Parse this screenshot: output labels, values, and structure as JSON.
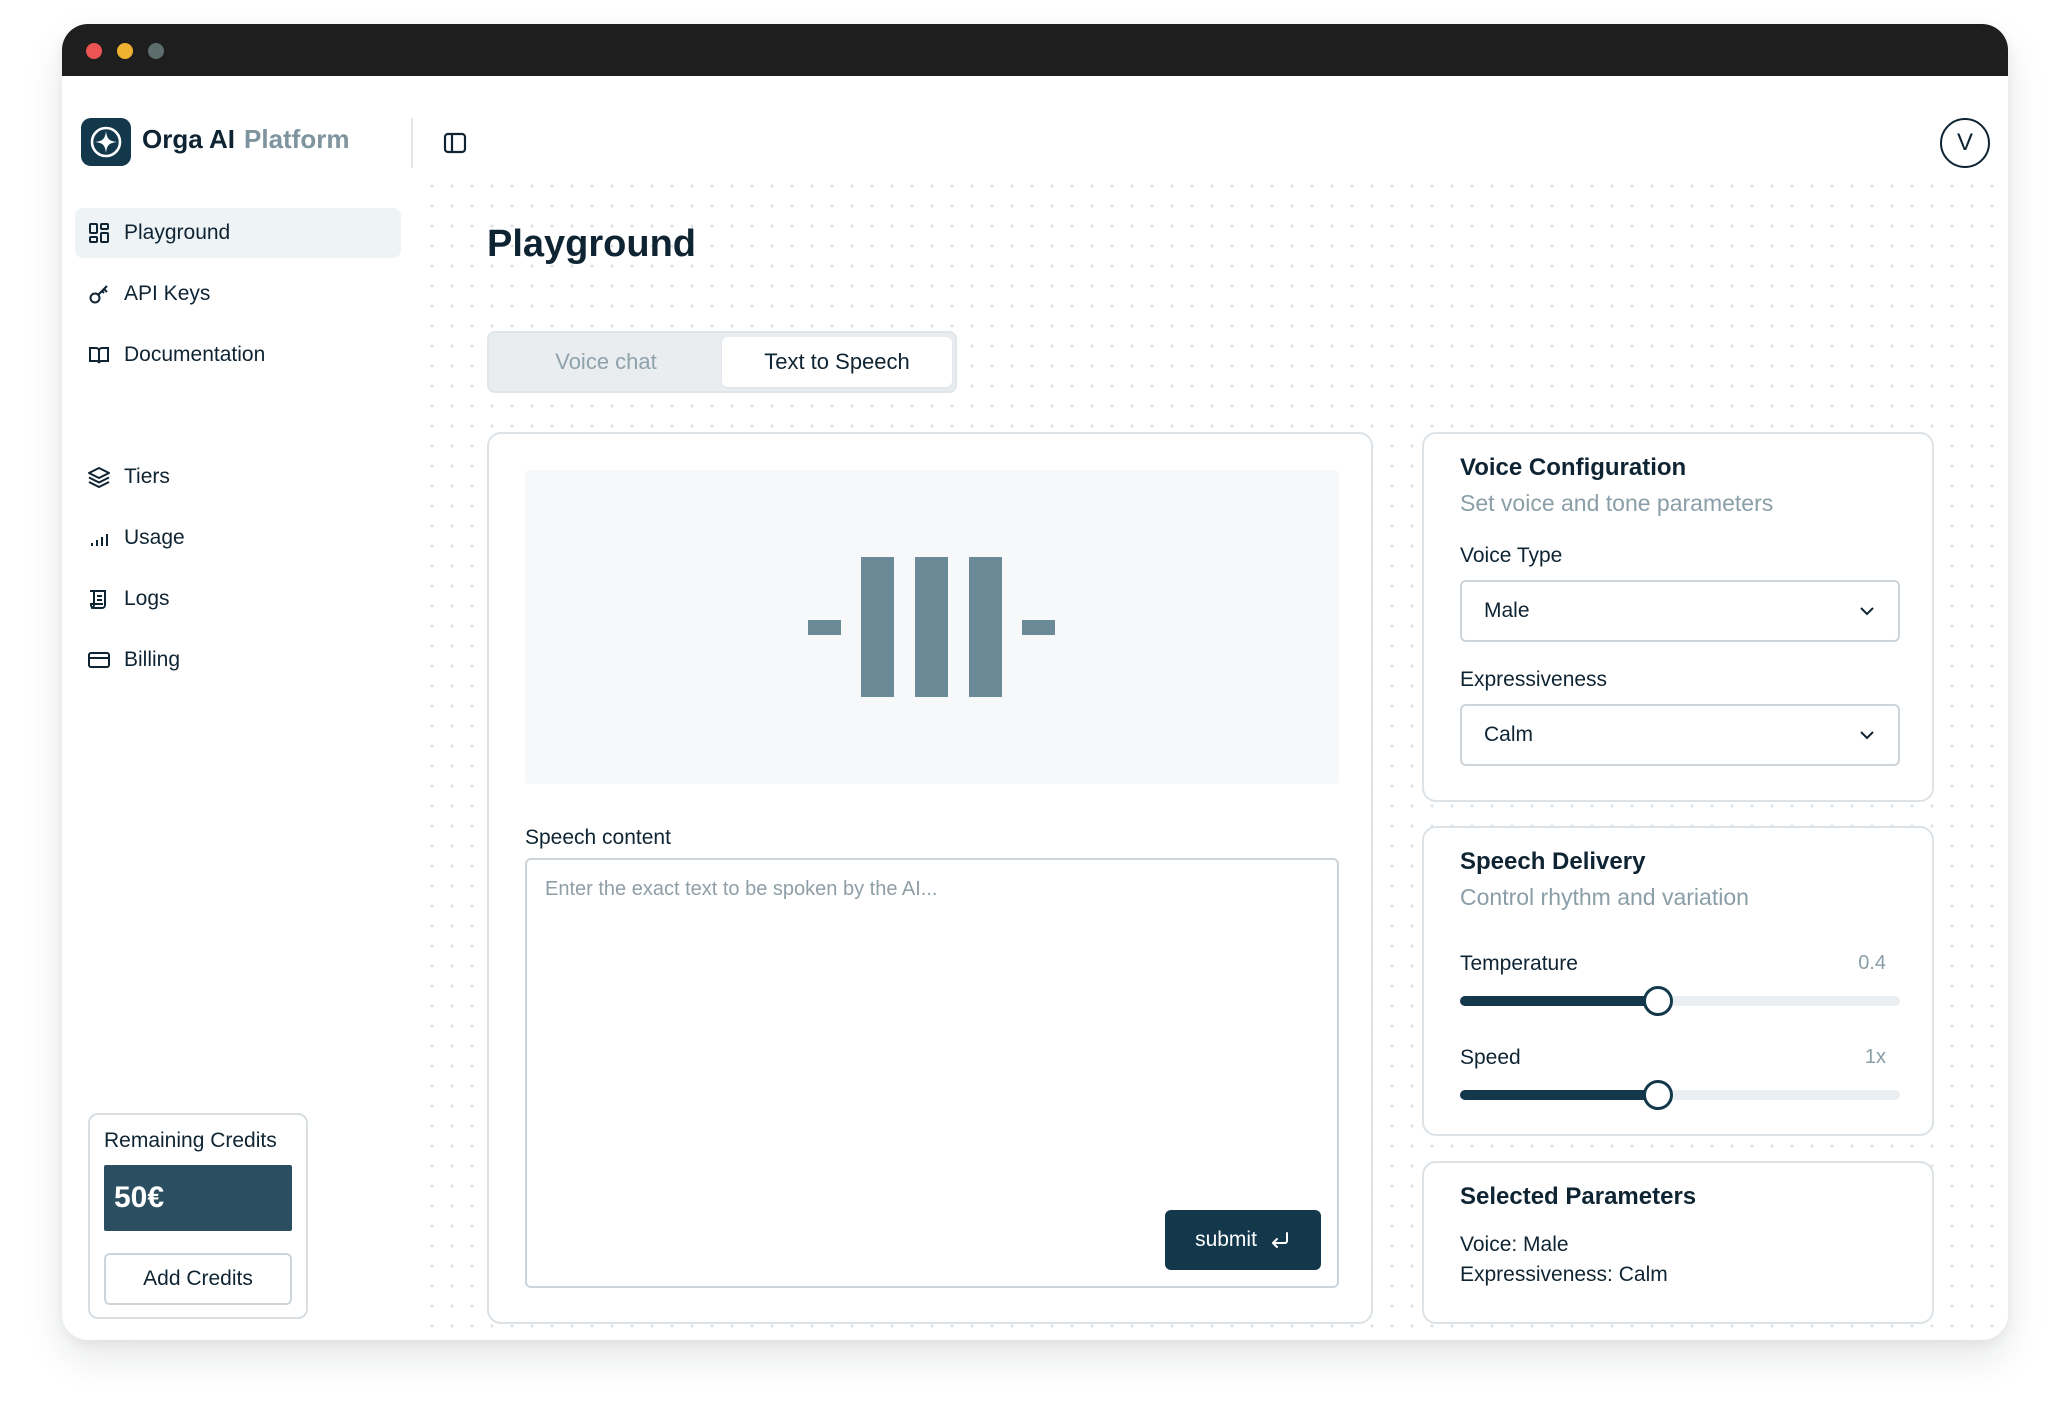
{
  "brand": {
    "name": "Orga AI",
    "sub": "Platform"
  },
  "user": {
    "initial": "V"
  },
  "sidebar": {
    "items": [
      {
        "label": "Playground",
        "icon": "grid-icon",
        "active": true
      },
      {
        "label": "API Keys",
        "icon": "key-icon"
      },
      {
        "label": "Documentation",
        "icon": "book-icon"
      },
      {
        "label": "Tiers",
        "icon": "layers-icon"
      },
      {
        "label": "Usage",
        "icon": "bar-chart-icon"
      },
      {
        "label": "Logs",
        "icon": "scroll-icon"
      },
      {
        "label": "Billing",
        "icon": "credit-card-icon"
      }
    ],
    "credits": {
      "title": "Remaining Credits",
      "value": "50€",
      "button": "Add Credits"
    }
  },
  "main": {
    "title": "Playground",
    "tabs": [
      {
        "label": "Voice chat",
        "active": false
      },
      {
        "label": "Text to Speech",
        "active": true
      }
    ],
    "speech": {
      "label": "Speech content",
      "placeholder": "Enter the exact text to be spoken by the AI...",
      "submit": "submit"
    }
  },
  "voice_config": {
    "title": "Voice Configuration",
    "subtitle": "Set voice and tone parameters",
    "voice_type_label": "Voice Type",
    "voice_type_value": "Male",
    "expressiveness_label": "Expressiveness",
    "expressiveness_value": "Calm"
  },
  "speech_delivery": {
    "title": "Speech Delivery",
    "subtitle": "Control rhythm and variation",
    "temperature_label": "Temperature",
    "temperature_value": "0.4",
    "temperature_fraction": 0.45,
    "speed_label": "Speed",
    "speed_value": "1x",
    "speed_fraction": 0.45
  },
  "selected_params": {
    "title": "Selected Parameters",
    "voice": "Voice: Male",
    "expressiveness": "Expressiveness: Calm"
  },
  "colors": {
    "primary": "#13384c",
    "credit_bg": "#2b4f61",
    "wave": "#6a8a98",
    "muted": "#8a9ea8"
  }
}
